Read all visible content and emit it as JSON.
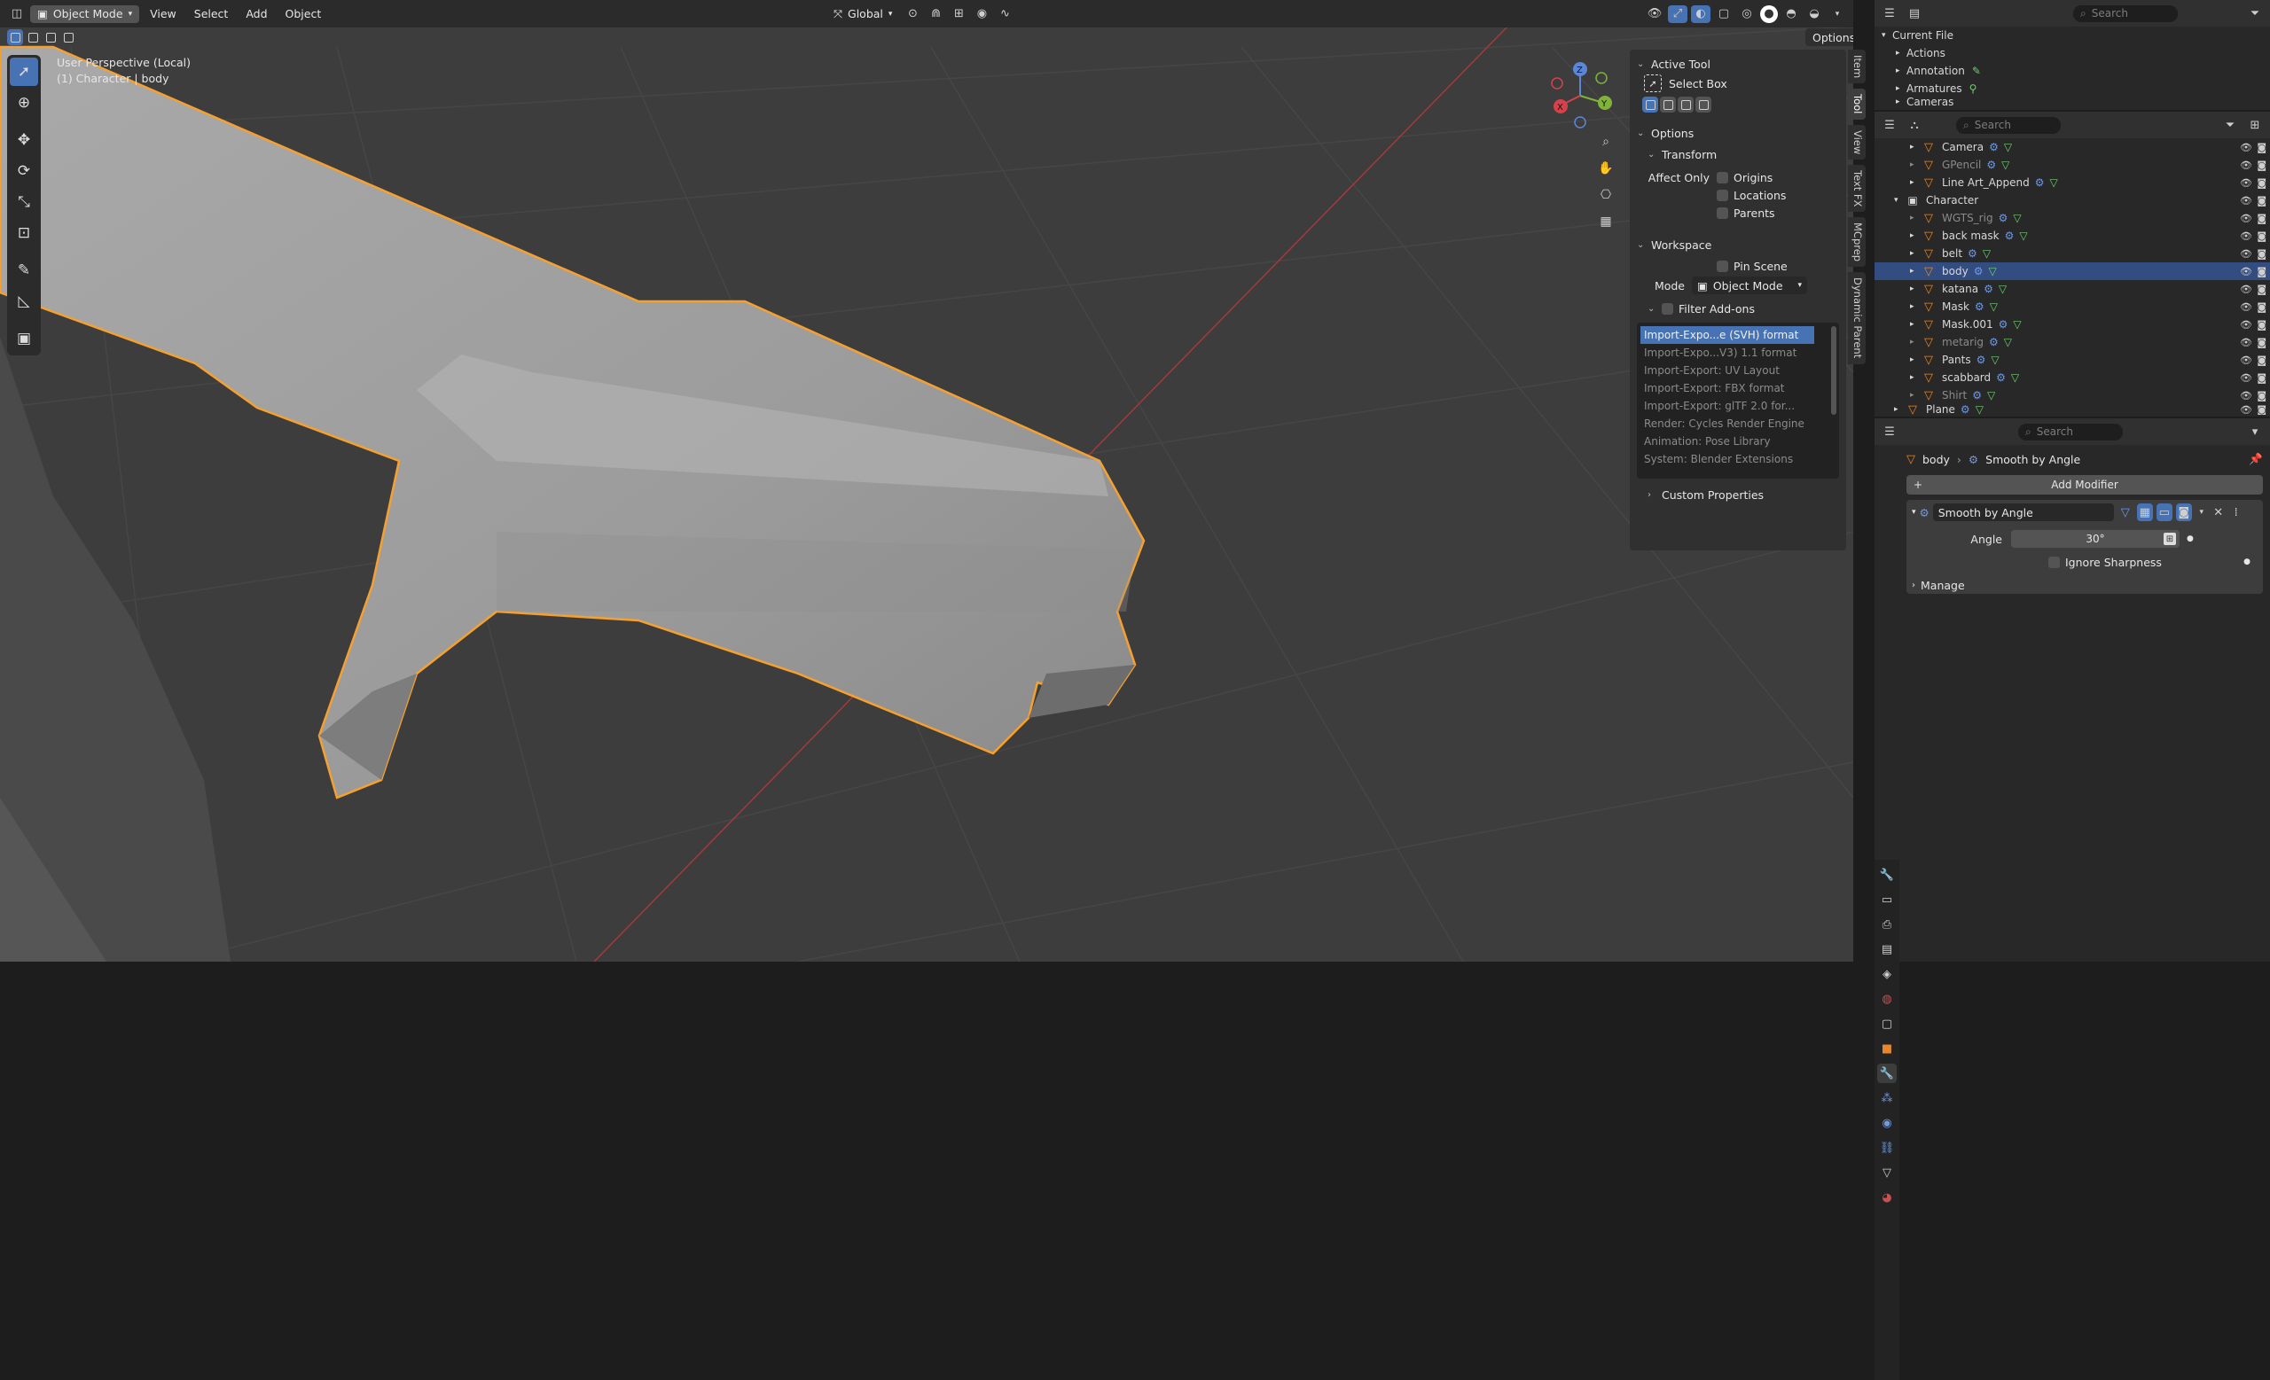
{
  "header": {
    "mode": "Object Mode",
    "menus": [
      "View",
      "Select",
      "Add",
      "Object"
    ],
    "orientation": "Global",
    "options_label": "Options"
  },
  "viewport": {
    "perspective": "User Perspective (Local)",
    "context": "(1) Character | body",
    "gizmo": {
      "x": "X",
      "y": "Y",
      "z": "Z"
    }
  },
  "npanel": {
    "active_tool_title": "Active Tool",
    "active_tool_name": "Select Box",
    "options_title": "Options",
    "transform_title": "Transform",
    "affect_only_label": "Affect Only",
    "affect_items": [
      "Origins",
      "Locations",
      "Parents"
    ],
    "workspace_title": "Workspace",
    "pin_scene": "Pin Scene",
    "mode_label": "Mode",
    "mode_value": "Object Mode",
    "filter_addons": "Filter Add-ons",
    "addons": [
      {
        "label": "Import-Expo...e (SVH) format",
        "selected": true
      },
      {
        "label": "Import-Expo...V3) 1.1 format",
        "selected": false
      },
      {
        "label": "Import-Export: UV Layout",
        "selected": false
      },
      {
        "label": "Import-Export: FBX format",
        "selected": false
      },
      {
        "label": "Import-Export: glTF 2.0 for...",
        "selected": false
      },
      {
        "label": "Render: Cycles Render Engine",
        "selected": false
      },
      {
        "label": "Animation: Pose Library",
        "selected": false
      },
      {
        "label": "System: Blender Extensions",
        "selected": false
      }
    ],
    "custom_properties": "Custom Properties",
    "tabs": [
      "Item",
      "Tool",
      "View",
      "Text FX",
      "MCprep",
      "Dynamic Parent"
    ]
  },
  "outliner_top": {
    "search_placeholder": "Search",
    "root": "Current File",
    "items": [
      "Actions",
      "Annotation",
      "Armatures",
      "Cameras"
    ]
  },
  "outliner": {
    "search_placeholder": "Search",
    "rows": [
      {
        "name": "Camera",
        "indent": 1,
        "dim": false,
        "selected": false
      },
      {
        "name": "GPencil",
        "indent": 1,
        "dim": true,
        "selected": false
      },
      {
        "name": "Line Art_Append",
        "indent": 1,
        "dim": false,
        "selected": false
      },
      {
        "name": "Character",
        "indent": 0,
        "dim": false,
        "selected": false
      },
      {
        "name": "WGTS_rig",
        "indent": 1,
        "dim": true,
        "selected": false
      },
      {
        "name": "back mask",
        "indent": 1,
        "dim": false,
        "selected": false
      },
      {
        "name": "belt",
        "indent": 1,
        "dim": false,
        "selected": false
      },
      {
        "name": "body",
        "indent": 1,
        "dim": false,
        "selected": true
      },
      {
        "name": "katana",
        "indent": 1,
        "dim": false,
        "selected": false
      },
      {
        "name": "Mask",
        "indent": 1,
        "dim": false,
        "selected": false
      },
      {
        "name": "Mask.001",
        "indent": 1,
        "dim": false,
        "selected": false
      },
      {
        "name": "metarig",
        "indent": 1,
        "dim": true,
        "selected": false
      },
      {
        "name": "Pants",
        "indent": 1,
        "dim": false,
        "selected": false
      },
      {
        "name": "scabbard",
        "indent": 1,
        "dim": false,
        "selected": false
      },
      {
        "name": "Shirt",
        "indent": 1,
        "dim": true,
        "selected": false
      },
      {
        "name": "Plane",
        "indent": 0,
        "dim": false,
        "selected": false
      }
    ]
  },
  "properties": {
    "search_placeholder": "Search",
    "breadcrumb_object": "body",
    "breadcrumb_modifier": "Smooth by Angle",
    "add_modifier": "Add Modifier",
    "modifier_name": "Smooth by Angle",
    "angle_label": "Angle",
    "angle_value": "30°",
    "ignore_sharpness": "Ignore Sharpness",
    "manage": "Manage"
  },
  "colors": {
    "accent": "#4772b3",
    "outline": "#f5a030",
    "selection_row": "#334d80"
  }
}
